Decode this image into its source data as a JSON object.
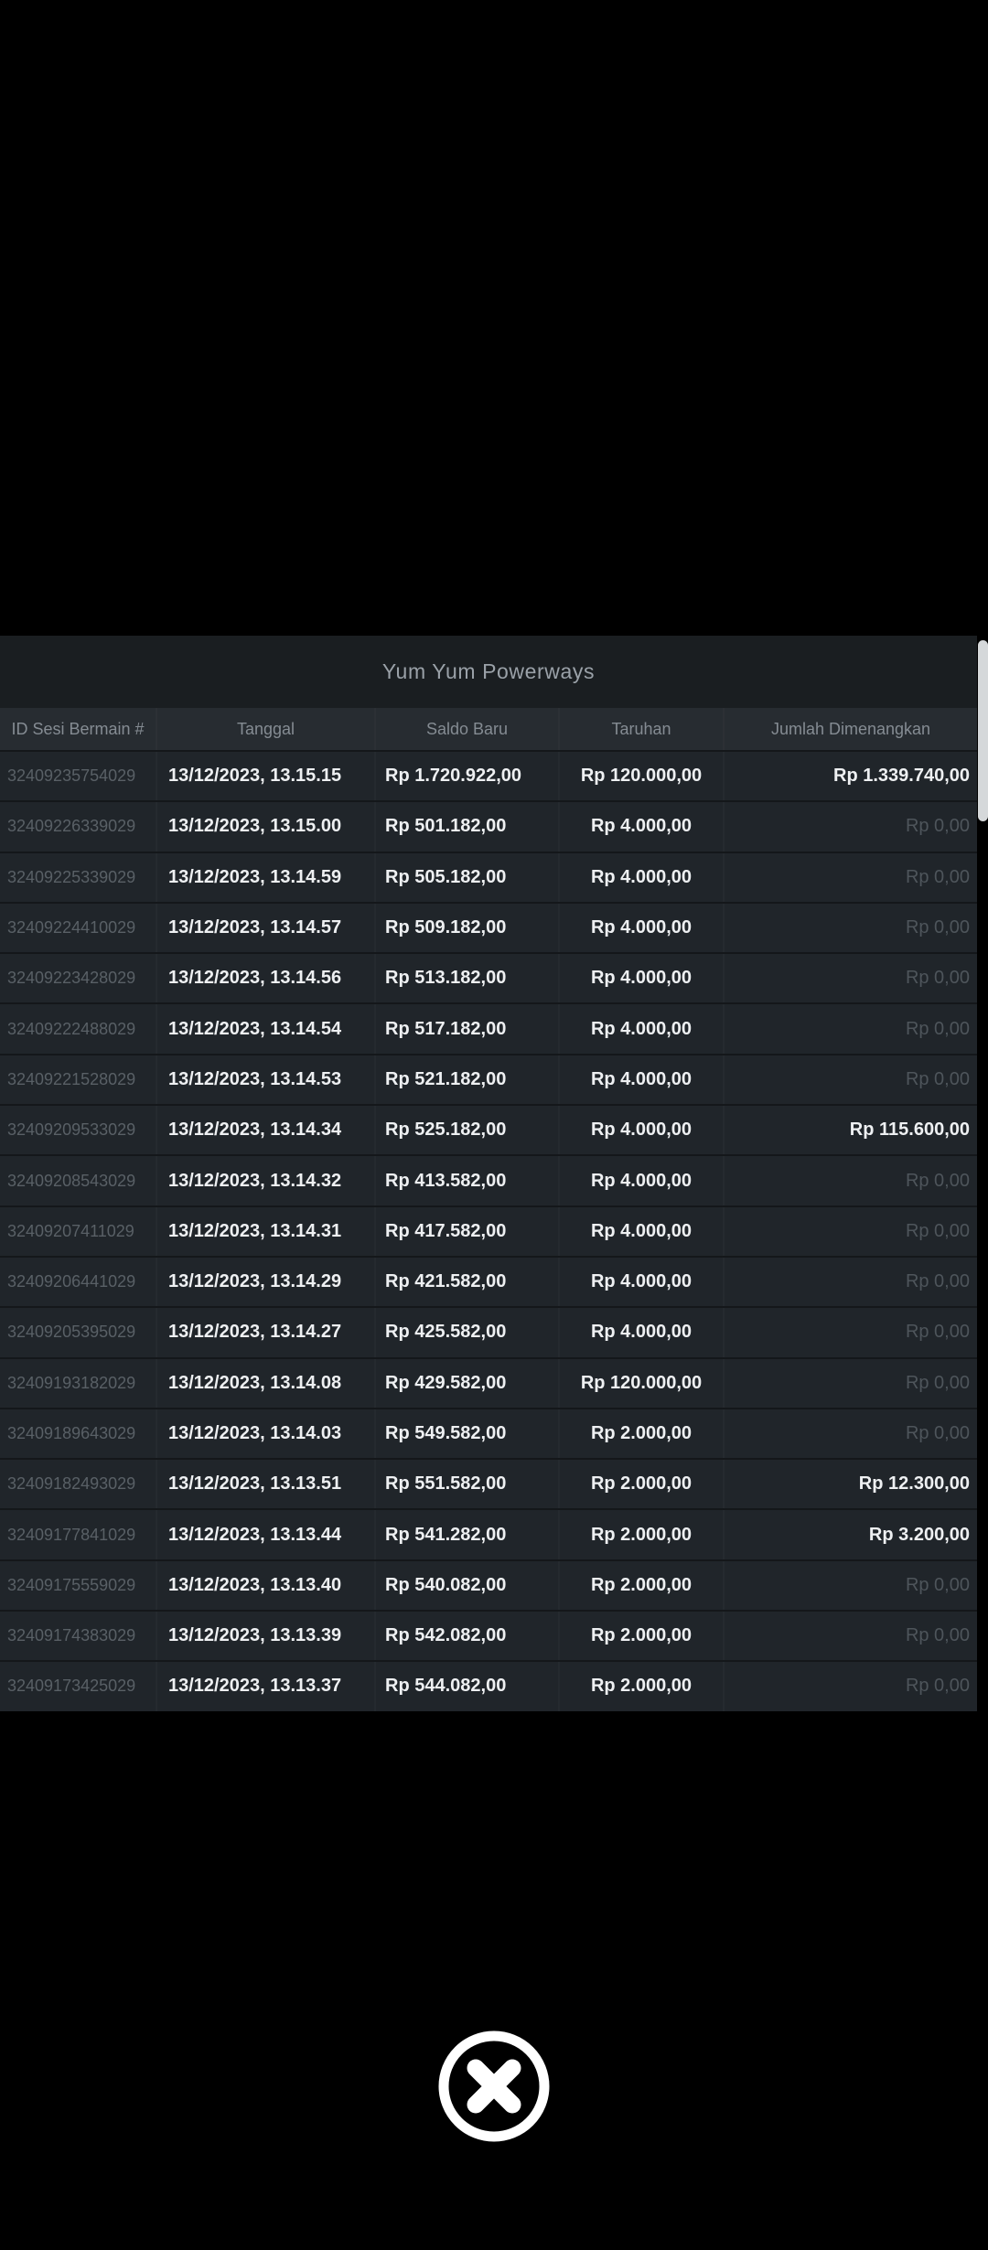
{
  "overlay": {
    "title": "Yum Yum Powerways",
    "columns": [
      "ID Sesi Bermain #",
      "Tanggal",
      "Saldo Baru",
      "Taruhan",
      "Jumlah Dimenangkan"
    ],
    "rows": [
      {
        "id": "32409235754029",
        "date": "13/12/2023, 13.15.15",
        "balance": "Rp 1.720.922,00",
        "bet": "Rp 120.000,00",
        "win": "Rp 1.339.740,00",
        "win_positive": true
      },
      {
        "id": "32409226339029",
        "date": "13/12/2023, 13.15.00",
        "balance": "Rp 501.182,00",
        "bet": "Rp 4.000,00",
        "win": "Rp 0,00",
        "win_positive": false
      },
      {
        "id": "32409225339029",
        "date": "13/12/2023, 13.14.59",
        "balance": "Rp 505.182,00",
        "bet": "Rp 4.000,00",
        "win": "Rp 0,00",
        "win_positive": false
      },
      {
        "id": "32409224410029",
        "date": "13/12/2023, 13.14.57",
        "balance": "Rp 509.182,00",
        "bet": "Rp 4.000,00",
        "win": "Rp 0,00",
        "win_positive": false
      },
      {
        "id": "32409223428029",
        "date": "13/12/2023, 13.14.56",
        "balance": "Rp 513.182,00",
        "bet": "Rp 4.000,00",
        "win": "Rp 0,00",
        "win_positive": false
      },
      {
        "id": "32409222488029",
        "date": "13/12/2023, 13.14.54",
        "balance": "Rp 517.182,00",
        "bet": "Rp 4.000,00",
        "win": "Rp 0,00",
        "win_positive": false
      },
      {
        "id": "32409221528029",
        "date": "13/12/2023, 13.14.53",
        "balance": "Rp 521.182,00",
        "bet": "Rp 4.000,00",
        "win": "Rp 0,00",
        "win_positive": false
      },
      {
        "id": "32409209533029",
        "date": "13/12/2023, 13.14.34",
        "balance": "Rp 525.182,00",
        "bet": "Rp 4.000,00",
        "win": "Rp 115.600,00",
        "win_positive": true
      },
      {
        "id": "32409208543029",
        "date": "13/12/2023, 13.14.32",
        "balance": "Rp 413.582,00",
        "bet": "Rp 4.000,00",
        "win": "Rp 0,00",
        "win_positive": false
      },
      {
        "id": "32409207411029",
        "date": "13/12/2023, 13.14.31",
        "balance": "Rp 417.582,00",
        "bet": "Rp 4.000,00",
        "win": "Rp 0,00",
        "win_positive": false
      },
      {
        "id": "32409206441029",
        "date": "13/12/2023, 13.14.29",
        "balance": "Rp 421.582,00",
        "bet": "Rp 4.000,00",
        "win": "Rp 0,00",
        "win_positive": false
      },
      {
        "id": "32409205395029",
        "date": "13/12/2023, 13.14.27",
        "balance": "Rp 425.582,00",
        "bet": "Rp 4.000,00",
        "win": "Rp 0,00",
        "win_positive": false
      },
      {
        "id": "32409193182029",
        "date": "13/12/2023, 13.14.08",
        "balance": "Rp 429.582,00",
        "bet": "Rp 120.000,00",
        "win": "Rp 0,00",
        "win_positive": false
      },
      {
        "id": "32409189643029",
        "date": "13/12/2023, 13.14.03",
        "balance": "Rp 549.582,00",
        "bet": "Rp 2.000,00",
        "win": "Rp 0,00",
        "win_positive": false
      },
      {
        "id": "32409182493029",
        "date": "13/12/2023, 13.13.51",
        "balance": "Rp 551.582,00",
        "bet": "Rp 2.000,00",
        "win": "Rp 12.300,00",
        "win_positive": true
      },
      {
        "id": "32409177841029",
        "date": "13/12/2023, 13.13.44",
        "balance": "Rp 541.282,00",
        "bet": "Rp 2.000,00",
        "win": "Rp 3.200,00",
        "win_positive": true
      },
      {
        "id": "32409175559029",
        "date": "13/12/2023, 13.13.40",
        "balance": "Rp 540.082,00",
        "bet": "Rp 2.000,00",
        "win": "Rp 0,00",
        "win_positive": false
      },
      {
        "id": "32409174383029",
        "date": "13/12/2023, 13.13.39",
        "balance": "Rp 542.082,00",
        "bet": "Rp 2.000,00",
        "win": "Rp 0,00",
        "win_positive": false
      },
      {
        "id": "32409173425029",
        "date": "13/12/2023, 13.13.37",
        "balance": "Rp 544.082,00",
        "bet": "Rp 2.000,00",
        "win": "Rp 0,00",
        "win_positive": false
      }
    ]
  },
  "colors": {
    "page_bg": "#000000",
    "panel_title_bg": "#1a1e21",
    "header_bg": "#272c31",
    "row_bg": "#20252a",
    "row_separator": "#14171a",
    "title_text": "#9aa1a8",
    "header_text": "#858c93",
    "id_text": "#596066",
    "value_text": "#eef0f2",
    "zero_text": "#4e555b",
    "scrollbar_thumb": "#d5d8da",
    "close_icon": "#ffffff"
  }
}
